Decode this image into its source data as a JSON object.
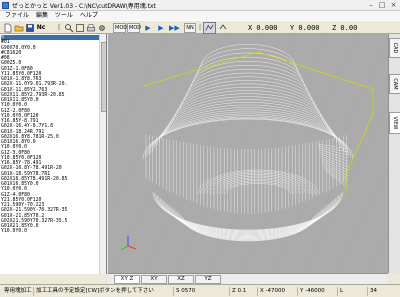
{
  "window": {
    "title": "ぜっとかっと Ver1.03 - C:\\NC\\cutDRAW\\専用塊.txt"
  },
  "menu": [
    "ファイル",
    "編集",
    "ツール",
    "ヘルプ"
  ],
  "toolbar": {
    "nc_label": "Nc",
    "play_buttons": [
      "▶",
      "▶",
      "▶▶"
    ],
    "mode_buttons": [
      "MOD",
      "MOD",
      "NN"
    ],
    "coord_x": "X 0.000",
    "coord_y": "Y 0.000",
    "coord_z": "Z 0.00"
  },
  "code_lines": [
    "%",
    "#01",
    "G90X70.0Y0.0",
    "#C81620",
    "#08",
    "G00Z5.0",
    "G01Z-1.0F80",
    "Y11.85Y0.0F120",
    "G01X-1.8Y8.763",
    "G02X-11.0Y9.01.793R-20.",
    "G01X-11.85Y2.763",
    "G02X11.85Y2.793R-20.85",
    "G01X11.85Y0.0",
    "Y10.0Y0.0",
    "G1Z-2.0F80",
    "Y10.0Y0.0F120",
    "Y16.85Y-8.791",
    "G02X-16.4Y-8.7Y1.8",
    "G01X-18.24R.791",
    "G02X16.8Y8.781R-25.0",
    "G01X16.8Y0.0",
    "Y10.0Y0.0",
    "G1Z-3.0F80",
    "Y10.85Y0.0F120",
    "Y16.85Y-78.491",
    "G02X-16.8Y-78.491R-20",
    "G01X-18.59Y78.7R1",
    "G02X16.85Y78.491R-20.85",
    "G01X16.85Y0.0",
    "Y10.0Y0.0",
    "G1Z-4.0F80",
    "Y21.85Y0.0F120",
    "Y21.590Y-70.223",
    "G02X-21.590Y-70.327R-35",
    "G01X-21.85Y70.2",
    "G02X21.590Y70.327R-35.5",
    "G01X21.85Y0.0",
    "Y10.0Y0.0"
  ],
  "right_tabs": [
    "CAD",
    "CAM",
    "VIEW"
  ],
  "bottom_tabs": [
    "XY Z",
    "XY",
    "XZ",
    "YZ"
  ],
  "status": {
    "s1": "専用塊加工",
    "s2": "加工工具の予定設定[CW]ボタンを押して下さい",
    "s3": "S 0570",
    "s4": "Z 0.1",
    "s5": "X -47000",
    "s6": "Y -46000",
    "s7": "L",
    "s8": "34"
  },
  "colors": {
    "view_bg": "#ababab",
    "toolpath": "#ffffff",
    "outline": "#d8d800"
  }
}
